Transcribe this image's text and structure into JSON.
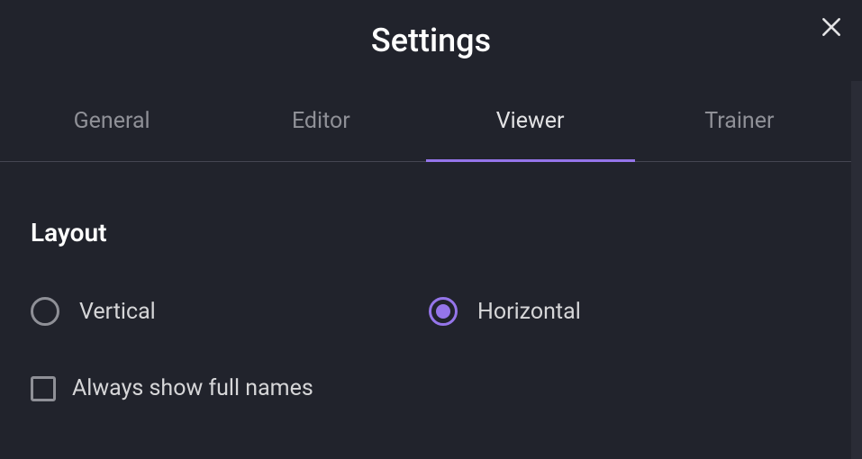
{
  "header": {
    "title": "Settings"
  },
  "tabs": {
    "general": "General",
    "editor": "Editor",
    "viewer": "Viewer",
    "trainer": "Trainer",
    "active": "viewer"
  },
  "section": {
    "layout_title": "Layout"
  },
  "layout": {
    "vertical_label": "Vertical",
    "horizontal_label": "Horizontal",
    "selected": "horizontal"
  },
  "checkbox": {
    "show_full_names_label": "Always show full names",
    "show_full_names_checked": false
  },
  "colors": {
    "accent": "#9575ea",
    "background": "#21232c",
    "text_primary": "#ffffff",
    "text_secondary": "#d6d6d8",
    "text_muted": "#8f9097"
  }
}
